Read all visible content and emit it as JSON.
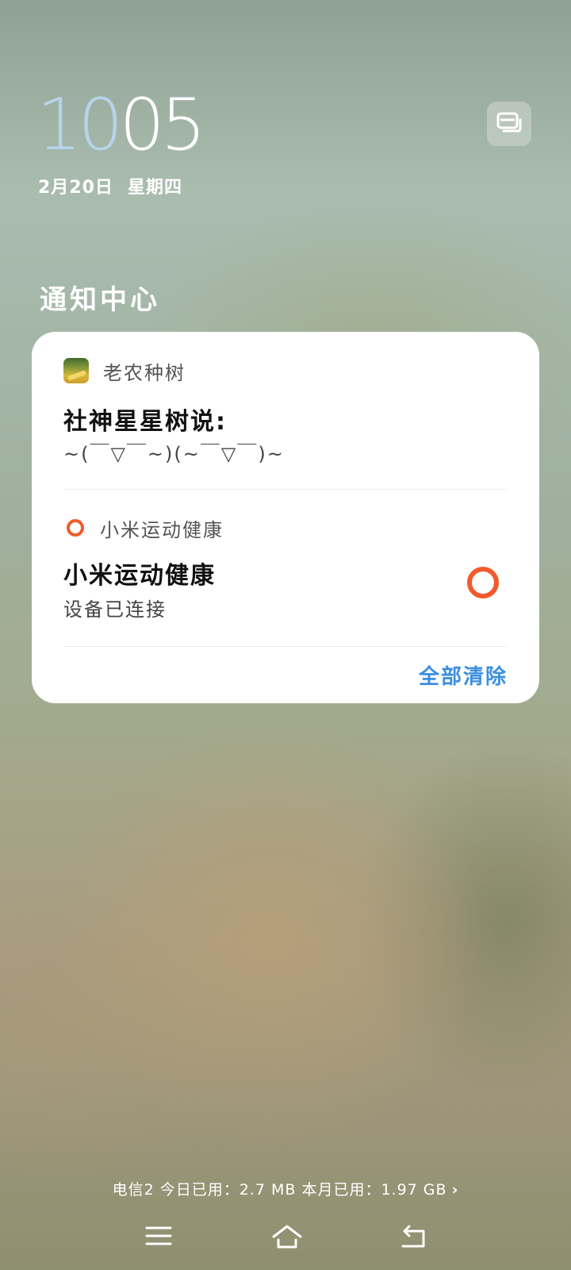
{
  "lockscreen": {
    "time_hour": "10",
    "time_minute": "05",
    "date": "2月20日",
    "weekday": "星期四",
    "system_button_icon": "notification-stack-icon"
  },
  "notification_center": {
    "title": "通知中心",
    "notifications": [
      {
        "app_name": "老农种树",
        "app_icon": "tree-app-icon",
        "title": "社神星星树说:",
        "body": "~(￣▽￣~)(~￣▽￣)~"
      },
      {
        "app_name": "小米运动健康",
        "app_icon": "ring-icon",
        "title": "小米运动健康",
        "body": "设备已连接",
        "accent_color": "#f15a2b"
      }
    ],
    "clear_all_label": "全部清除"
  },
  "status": {
    "data_usage": "电信2 今日已用：2.7 MB 本月已用：1.97 GB",
    "chevron": "›"
  },
  "navbar": {
    "menu_icon": "menu-icon",
    "home_icon": "home-icon",
    "back_icon": "back-icon"
  },
  "colors": {
    "accent_blue": "#3b8fe0",
    "hour_color": "#b8d2ea",
    "mi_fit_orange": "#f15a2b"
  }
}
